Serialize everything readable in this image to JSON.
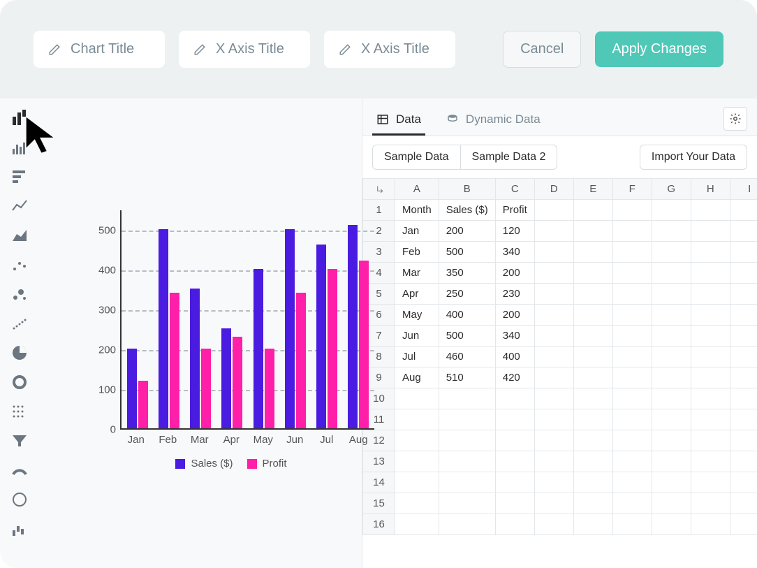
{
  "topbar": {
    "chart_title_placeholder": "Chart Title",
    "x_axis_placeholder": "X Axis Title",
    "x_axis_placeholder_2": "X Axis Title",
    "cancel": "Cancel",
    "apply": "Apply Changes"
  },
  "tabs": {
    "data": "Data",
    "dynamic": "Dynamic Data"
  },
  "samples": {
    "s1": "Sample Data",
    "s2": "Sample Data 2",
    "import": "Import Your Data"
  },
  "sheet": {
    "cols": [
      "A",
      "B",
      "C",
      "D",
      "E",
      "F",
      "G",
      "H",
      "I"
    ],
    "rows": [
      [
        "Month",
        "Sales ($)",
        "Profit",
        "",
        "",
        "",
        "",
        "",
        ""
      ],
      [
        "Jan",
        "200",
        "120",
        "",
        "",
        "",
        "",
        "",
        ""
      ],
      [
        "Feb",
        "500",
        "340",
        "",
        "",
        "",
        "",
        "",
        ""
      ],
      [
        "Mar",
        "350",
        "200",
        "",
        "",
        "",
        "",
        "",
        ""
      ],
      [
        "Apr",
        "250",
        "230",
        "",
        "",
        "",
        "",
        "",
        ""
      ],
      [
        "May",
        "400",
        "200",
        "",
        "",
        "",
        "",
        "",
        ""
      ],
      [
        "Jun",
        "500",
        "340",
        "",
        "",
        "",
        "",
        "",
        ""
      ],
      [
        "Jul",
        "460",
        "400",
        "",
        "",
        "",
        "",
        "",
        ""
      ],
      [
        "Aug",
        "510",
        "420",
        "",
        "",
        "",
        "",
        "",
        ""
      ],
      [
        "",
        "",
        "",
        "",
        "",
        "",
        "",
        "",
        ""
      ],
      [
        "",
        "",
        "",
        "",
        "",
        "",
        "",
        "",
        ""
      ],
      [
        "",
        "",
        "",
        "",
        "",
        "",
        "",
        "",
        ""
      ],
      [
        "",
        "",
        "",
        "",
        "",
        "",
        "",
        "",
        ""
      ],
      [
        "",
        "",
        "",
        "",
        "",
        "",
        "",
        "",
        ""
      ],
      [
        "",
        "",
        "",
        "",
        "",
        "",
        "",
        "",
        ""
      ],
      [
        "",
        "",
        "",
        "",
        "",
        "",
        "",
        "",
        ""
      ]
    ]
  },
  "chart_data": {
    "type": "bar",
    "categories": [
      "Jan",
      "Feb",
      "Mar",
      "Apr",
      "May",
      "Jun",
      "Jul",
      "Aug"
    ],
    "series": [
      {
        "name": "Sales ($)",
        "color": "#4a1be0",
        "values": [
          200,
          500,
          350,
          250,
          400,
          500,
          460,
          510
        ]
      },
      {
        "name": "Profit",
        "color": "#ff1fa8",
        "values": [
          120,
          340,
          200,
          230,
          200,
          340,
          400,
          420
        ]
      }
    ],
    "yticks": [
      0,
      100,
      200,
      300,
      400,
      500
    ],
    "ylim": [
      0,
      550
    ]
  },
  "legend": {
    "s1": "Sales ($)",
    "s2": "Profit"
  },
  "colors": {
    "accent": "#4fc8b8",
    "series1": "#4a1be0",
    "series2": "#ff1fa8"
  }
}
